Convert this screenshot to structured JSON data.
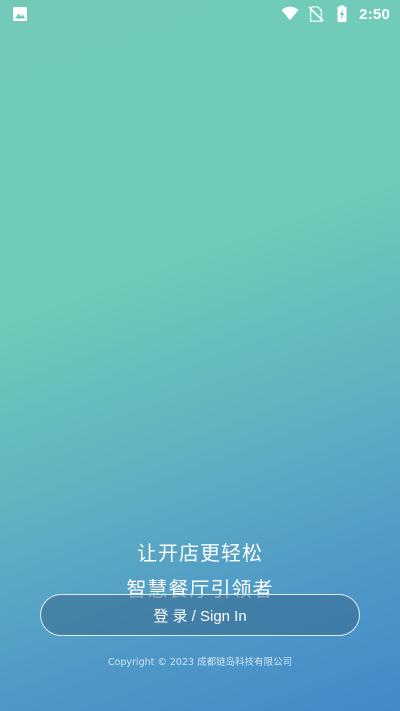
{
  "status_bar": {
    "left_icon": "image-icon",
    "wifi_icon": "wifi-icon",
    "sim_icon": "no-sim-icon",
    "battery_icon": "battery-charging-icon",
    "time": "2:50"
  },
  "slogan": {
    "line1": "让开店更轻松",
    "line2": "智慧餐厅引领者"
  },
  "login_button": {
    "label": "登 录 / Sign In"
  },
  "footer": {
    "copyright": "Copyright © 2023 成都链岛科技有限公司"
  },
  "colors": {
    "gradient_top": "#72cbb8",
    "gradient_bottom": "#438ac8",
    "button_fill": "#37698c"
  }
}
